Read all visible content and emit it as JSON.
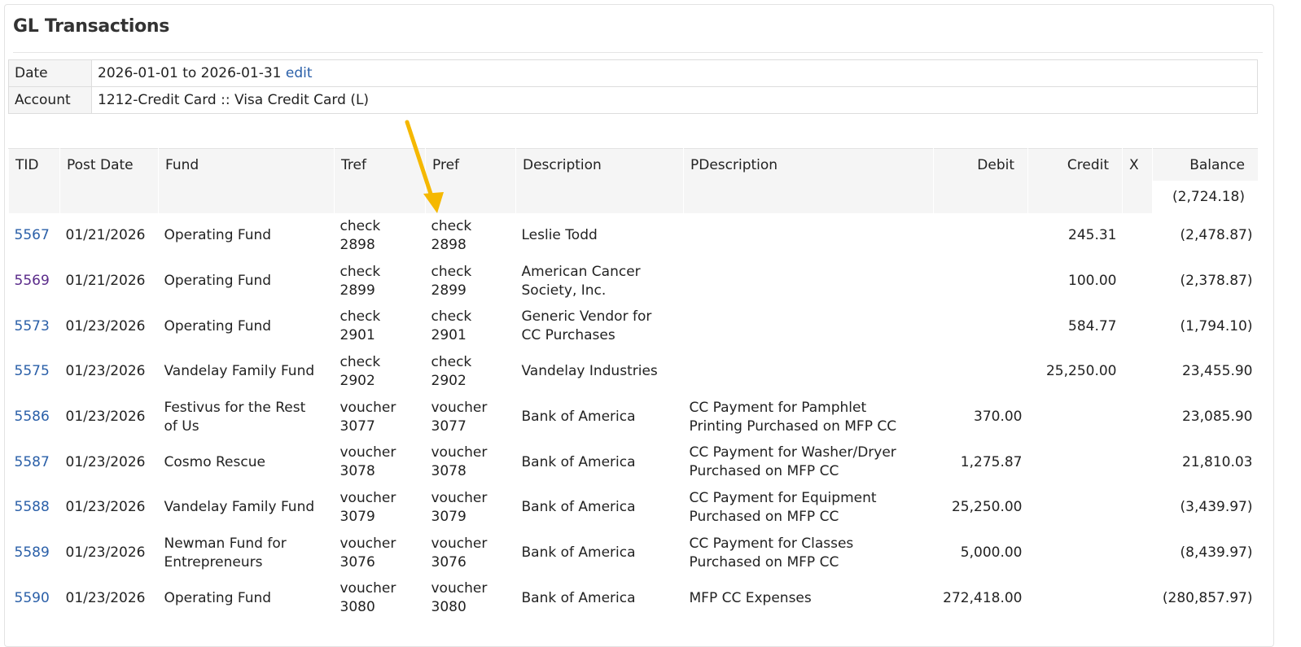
{
  "page_title": "GL Transactions",
  "filters": {
    "date_label": "Date",
    "date_range": "2026-01-01 to 2026-01-31",
    "edit_link": "edit",
    "account_label": "Account",
    "account_value": "1212-Credit Card :: Visa Credit Card (L)"
  },
  "columns": {
    "tid": "TID",
    "post_date": "Post Date",
    "fund": "Fund",
    "tref": "Tref",
    "pref": "Pref",
    "description": "Description",
    "pdescription": "PDescription",
    "debit": "Debit",
    "credit": "Credit",
    "x": "X",
    "balance": "Balance"
  },
  "opening_balance": "(2,724.18)",
  "rows": [
    {
      "tid": "5567",
      "visited": false,
      "post_date": "01/21/2026",
      "fund": "Operating Fund",
      "tref": [
        "check",
        "2898"
      ],
      "pref": [
        "check",
        "2898"
      ],
      "description": [
        "Leslie Todd"
      ],
      "pdescription": [],
      "debit": "",
      "credit": "245.31",
      "balance": "(2,478.87)"
    },
    {
      "tid": "5569",
      "visited": true,
      "post_date": "01/21/2026",
      "fund": "Operating Fund",
      "tref": [
        "check",
        "2899"
      ],
      "pref": [
        "check",
        "2899"
      ],
      "description": [
        "American Cancer",
        "Society, Inc."
      ],
      "pdescription": [],
      "debit": "",
      "credit": "100.00",
      "balance": "(2,378.87)"
    },
    {
      "tid": "5573",
      "visited": false,
      "post_date": "01/23/2026",
      "fund": "Operating Fund",
      "tref": [
        "check",
        "2901"
      ],
      "pref": [
        "check",
        "2901"
      ],
      "description": [
        "Generic Vendor for",
        "CC Purchases"
      ],
      "pdescription": [],
      "debit": "",
      "credit": "584.77",
      "balance": "(1,794.10)"
    },
    {
      "tid": "5575",
      "visited": false,
      "post_date": "01/23/2026",
      "fund": "Vandelay Family Fund",
      "tref": [
        "check",
        "2902"
      ],
      "pref": [
        "check",
        "2902"
      ],
      "description": [
        "Vandelay Industries"
      ],
      "pdescription": [],
      "debit": "",
      "credit": "25,250.00",
      "balance": "23,455.90"
    },
    {
      "tid": "5586",
      "visited": false,
      "post_date": "01/23/2026",
      "fund": [
        "Festivus for the Rest",
        "of Us"
      ],
      "tref": [
        "voucher",
        "3077"
      ],
      "pref": [
        "voucher",
        "3077"
      ],
      "description": [
        "Bank of America"
      ],
      "pdescription": [
        "CC Payment for Pamphlet",
        "Printing Purchased on MFP CC"
      ],
      "debit": "370.00",
      "credit": "",
      "balance": "23,085.90"
    },
    {
      "tid": "5587",
      "visited": false,
      "post_date": "01/23/2026",
      "fund": "Cosmo Rescue",
      "tref": [
        "voucher",
        "3078"
      ],
      "pref": [
        "voucher",
        "3078"
      ],
      "description": [
        "Bank of America"
      ],
      "pdescription": [
        "CC Payment for Washer/Dryer",
        "Purchased on MFP CC"
      ],
      "debit": "1,275.87",
      "credit": "",
      "balance": "21,810.03"
    },
    {
      "tid": "5588",
      "visited": false,
      "post_date": "01/23/2026",
      "fund": "Vandelay Family Fund",
      "tref": [
        "voucher",
        "3079"
      ],
      "pref": [
        "voucher",
        "3079"
      ],
      "description": [
        "Bank of America"
      ],
      "pdescription": [
        "CC Payment for Equipment",
        "Purchased on MFP CC"
      ],
      "debit": "25,250.00",
      "credit": "",
      "balance": "(3,439.97)"
    },
    {
      "tid": "5589",
      "visited": false,
      "post_date": "01/23/2026",
      "fund": [
        "Newman Fund for",
        "Entrepreneurs"
      ],
      "tref": [
        "voucher",
        "3076"
      ],
      "pref": [
        "voucher",
        "3076"
      ],
      "description": [
        "Bank of America"
      ],
      "pdescription": [
        "CC Payment for Classes",
        "Purchased on MFP CC"
      ],
      "debit": "5,000.00",
      "credit": "",
      "balance": "(8,439.97)"
    },
    {
      "tid": "5590",
      "visited": false,
      "post_date": "01/23/2026",
      "fund": "Operating Fund",
      "tref": [
        "voucher",
        "3080"
      ],
      "pref": [
        "voucher",
        "3080"
      ],
      "description": [
        "Bank of America"
      ],
      "pdescription": [
        "MFP CC Expenses"
      ],
      "debit": "272,418.00",
      "credit": "",
      "balance": "(280,857.97)"
    }
  ],
  "colors": {
    "link": "#2a5fa8",
    "visited_link": "#5a2a8a",
    "header_bg": "#f5f5f5",
    "annotation_arrow": "#f5b800"
  },
  "annotation": {
    "icon": "arrow-down-icon"
  }
}
